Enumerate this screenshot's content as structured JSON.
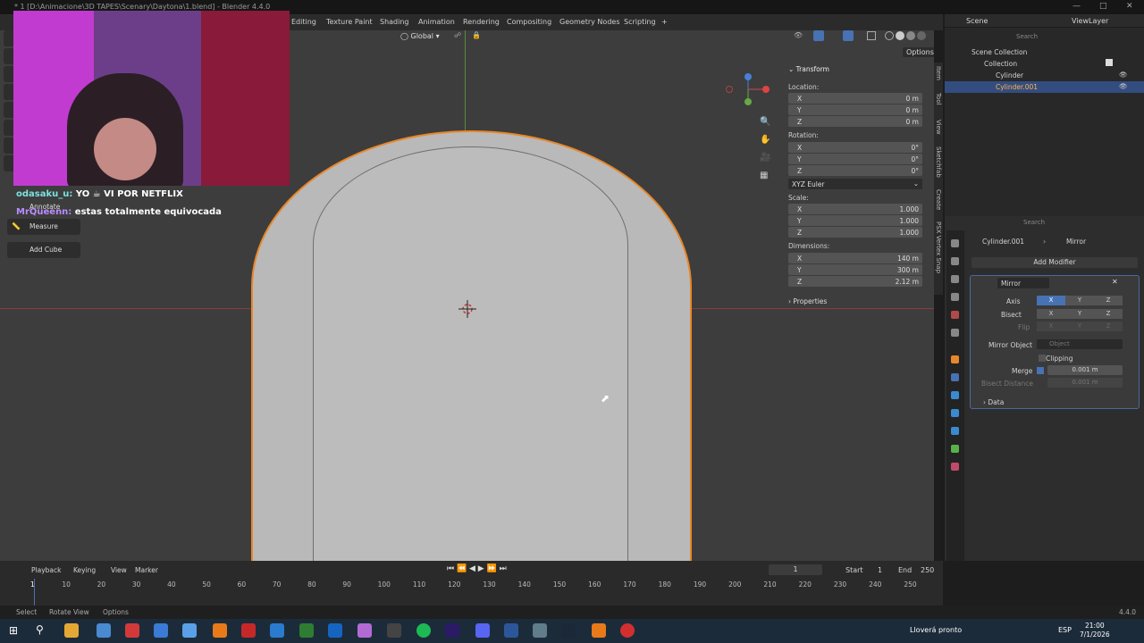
{
  "window": {
    "title": "* 1 [D:\\Animacione\\3D TAPES\\Scenary\\Daytona\\1.blend] - Blender 4.4.0"
  },
  "workspace_tabs": [
    "Editing",
    "Texture Paint",
    "Shading",
    "Animation",
    "Rendering",
    "Compositing",
    "Geometry Nodes",
    "Scripting",
    "+"
  ],
  "viewport": {
    "transform_orientation": "Global",
    "options_label": "Options",
    "tools": {
      "annotate": "Annotate",
      "measure": "Measure",
      "add_cube": "Add Cube"
    }
  },
  "chat": [
    {
      "user": "odasaku_u:",
      "text": "YO ☕ VI POR NETFLIX",
      "user_color": "#7ee0e0"
    },
    {
      "user": "MrQueenn:",
      "text": "estas totalmente equivocada",
      "user_color": "#b98cff"
    }
  ],
  "n_panel": {
    "section": "Transform",
    "location_label": "Location:",
    "location": [
      {
        "axis": "X",
        "value": "0 m"
      },
      {
        "axis": "Y",
        "value": "0 m"
      },
      {
        "axis": "Z",
        "value": "0 m"
      }
    ],
    "rotation_label": "Rotation:",
    "rotation": [
      {
        "axis": "X",
        "value": "0°"
      },
      {
        "axis": "Y",
        "value": "0°"
      },
      {
        "axis": "Z",
        "value": "0°"
      }
    ],
    "rotation_mode": "XYZ Euler",
    "scale_label": "Scale:",
    "scale": [
      {
        "axis": "X",
        "value": "1.000"
      },
      {
        "axis": "Y",
        "value": "1.000"
      },
      {
        "axis": "Z",
        "value": "1.000"
      }
    ],
    "dimensions_label": "Dimensions:",
    "dimensions": [
      {
        "axis": "X",
        "value": "140 m"
      },
      {
        "axis": "Y",
        "value": "300 m"
      },
      {
        "axis": "Z",
        "value": "2.12 m"
      }
    ],
    "properties": "Properties",
    "side_tabs": [
      "Item",
      "Tool",
      "View",
      "Sketchfab",
      "Create",
      "PSX Vertex Snap"
    ]
  },
  "header_right": {
    "scene": "Scene",
    "view_layer": "ViewLayer",
    "search_placeholder": "Search"
  },
  "outliner": {
    "root": "Scene Collection",
    "collection": "Collection",
    "items": [
      "Cylinder",
      "Cylinder.001"
    ]
  },
  "properties": {
    "search_placeholder": "Search",
    "breadcrumb_object": "Cylinder.001",
    "breadcrumb_modifier": "Mirror",
    "add_modifier": "Add Modifier",
    "modifier_name": "Mirror",
    "axis_label": "Axis",
    "bisect_label": "Bisect",
    "flip_label": "Flip",
    "xyz": [
      "X",
      "Y",
      "Z"
    ],
    "mirror_object_label": "Mirror Object",
    "mirror_object_placeholder": "Object",
    "clipping_label": "Clipping",
    "merge_label": "Merge",
    "merge_value": "0.001 m",
    "bisect_distance_label": "Bisect Distance",
    "bisect_distance_value": "0.001 m",
    "data_label": "Data"
  },
  "timeline": {
    "menus": [
      "Playback",
      "Keying",
      "View",
      "Marker"
    ],
    "current_frame": "1",
    "start_label": "Start",
    "start": "1",
    "end_label": "End",
    "end": "250",
    "ticks": [
      "1",
      "10",
      "20",
      "30",
      "40",
      "50",
      "60",
      "70",
      "80",
      "90",
      "100",
      "110",
      "120",
      "130",
      "140",
      "150",
      "160",
      "170",
      "180",
      "190",
      "200",
      "210",
      "220",
      "230",
      "240",
      "250"
    ]
  },
  "status": {
    "select": "Select",
    "rotate": "Rotate View",
    "options": "Options",
    "version": "4.4.0"
  },
  "taskbar": {
    "weather": "Lloverá pronto",
    "lang": "ESP",
    "time": "21:00",
    "date": "7/1/2026"
  }
}
